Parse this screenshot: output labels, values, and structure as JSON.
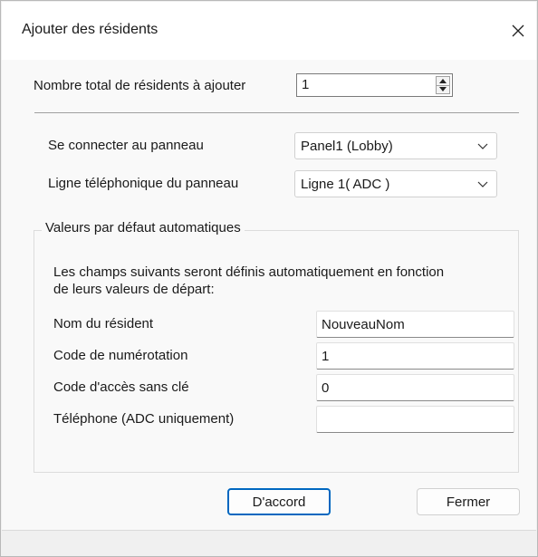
{
  "window": {
    "title": "Ajouter des résidents"
  },
  "count": {
    "label": "Nombre total de résidents à ajouter",
    "value": "1"
  },
  "connect": {
    "label": "Se connecter au panneau",
    "value": "Panel1 (Lobby)"
  },
  "line": {
    "label": "Ligne téléphonique du panneau",
    "value": "Ligne 1( ADC )"
  },
  "defaults": {
    "legend": "Valeurs par défaut automatiques",
    "description_1": "Les champs suivants seront définis automatiquement en fonction",
    "description_2": "de leurs valeurs de départ:",
    "fields": [
      {
        "label": "Nom du résident",
        "value": "NouveauNom"
      },
      {
        "label": "Code de numérotation",
        "value": "1"
      },
      {
        "label": "Code d'accès sans clé",
        "value": "0"
      },
      {
        "label": "Téléphone (ADC uniquement)",
        "value": ""
      }
    ]
  },
  "buttons": {
    "ok": "D'accord",
    "close": "Fermer"
  },
  "colors": {
    "accent": "#0067c0",
    "background": "#f9f9f9"
  }
}
